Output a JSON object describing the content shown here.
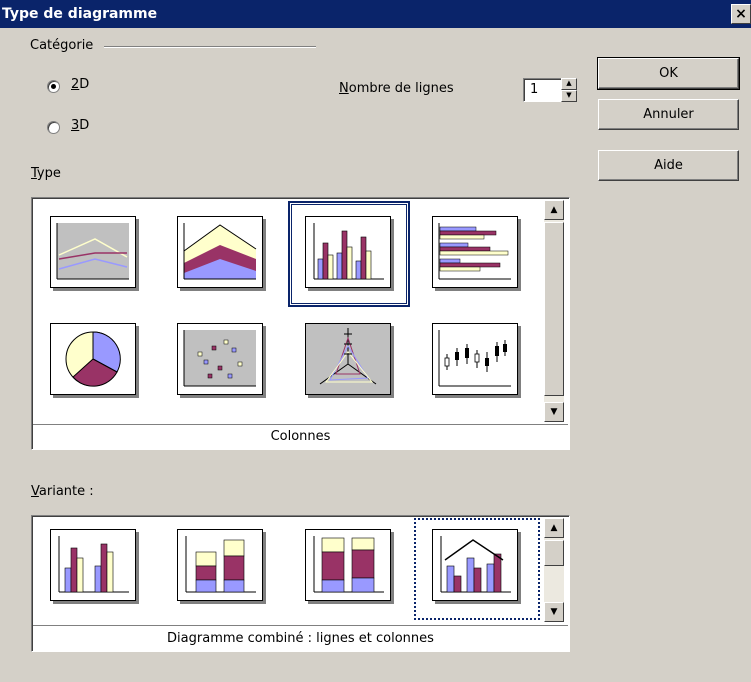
{
  "window": {
    "title": "Type de diagramme",
    "close_glyph": "×"
  },
  "categorie": {
    "label": "Catégorie",
    "options": [
      {
        "key": "2",
        "rest": "D",
        "selected": true
      },
      {
        "key": "3",
        "rest": "D",
        "selected": false
      }
    ]
  },
  "rows": {
    "label_key": "N",
    "label_rest": "ombre de lignes",
    "value": "1"
  },
  "buttons": {
    "ok": "OK",
    "cancel": "Annuler",
    "help": "Aide"
  },
  "type": {
    "label_key": "T",
    "label_rest": "ype",
    "items": [
      {
        "icon": "line-chart-icon"
      },
      {
        "icon": "area-chart-icon"
      },
      {
        "icon": "column-chart-icon",
        "selected": true
      },
      {
        "icon": "bar-chart-icon"
      },
      {
        "icon": "pie-chart-icon"
      },
      {
        "icon": "xy-scatter-chart-icon"
      },
      {
        "icon": "net-chart-icon"
      },
      {
        "icon": "stock-chart-icon"
      }
    ],
    "caption": "Colonnes"
  },
  "variante": {
    "label_key": "V",
    "label_rest": "ariante :",
    "items": [
      {
        "icon": "normal-columns-icon"
      },
      {
        "icon": "stacked-columns-icon"
      },
      {
        "icon": "percent-stacked-columns-icon"
      },
      {
        "icon": "columns-and-lines-icon",
        "selected": true
      }
    ],
    "caption": "Diagramme combiné : lignes et colonnes"
  },
  "colors": {
    "purple": "#993366",
    "blue": "#9999ff",
    "cream": "#ffffcc",
    "titlebar": "#0a246a"
  }
}
